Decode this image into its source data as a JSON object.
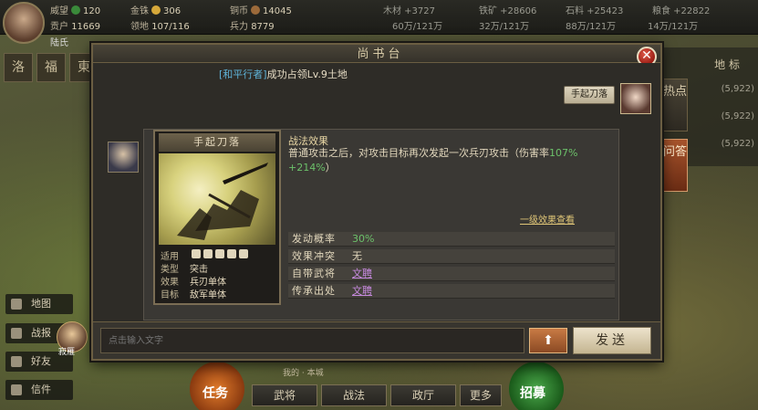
{
  "top_bar": {
    "res_row1": [
      {
        "label": "威望",
        "value": "120"
      },
      {
        "label": "金铢",
        "value": "306"
      },
      {
        "label": "铜币",
        "value": "14045"
      }
    ],
    "res_row2": [
      {
        "label": "贡户",
        "value": "11669"
      },
      {
        "label": "领地",
        "value": "107/116"
      },
      {
        "label": "兵力",
        "value": "8779"
      }
    ],
    "right_res_row1": [
      "木材 +3727",
      "铁矿 +28606",
      "石料 +25423",
      "粮食 +22822"
    ],
    "right_res_row2": [
      "60万/121万",
      "32万/121万",
      "88万/121万",
      "14万/121万"
    ],
    "player_name": "陆氏"
  },
  "left_tabs": [
    "洛",
    "福",
    "東"
  ],
  "left_menu": [
    "地图",
    "战报",
    "好友",
    "信件"
  ],
  "bottom_bar": {
    "tasks_label": "任务",
    "hero_name": "寂雁",
    "buttons": [
      "武将",
      "战法",
      "政厅",
      "更多"
    ],
    "recruit_label": "招募",
    "status_text": "我的 · 本城"
  },
  "right_panel": {
    "header_label": "地 标",
    "coord_rows": [
      "(5,922)",
      "(5,922)",
      "(5,922)"
    ]
  },
  "dialog": {
    "title": "尚书台",
    "close_glyph": "✕",
    "system_tag": "[和平行者]",
    "system_text": "成功占领Lv.9土地",
    "self_bubble": "手起刀落",
    "skill": {
      "name": "手起刀落",
      "effect_title": "战法效果",
      "desc_pre": "普通攻击之后，对攻击目标再次发起一次兵刃攻击（伤害率",
      "pct_from": "107%",
      "pct_to": "+214%",
      "desc_post": "）",
      "level_link": "一级效果查看",
      "props": [
        {
          "key": "适用",
          "value": ""
        },
        {
          "key": "类型",
          "value": "突击"
        },
        {
          "key": "效果",
          "value": "兵刃单体"
        },
        {
          "key": "目标",
          "value": "敌军单体"
        }
      ],
      "attrs": [
        {
          "key": "发动概率",
          "value": "30%",
          "style": "green"
        },
        {
          "key": "效果冲突",
          "value": "无",
          "style": "plain"
        },
        {
          "key": "自带武将",
          "value": "文聘",
          "style": "link"
        },
        {
          "key": "传承出处",
          "value": "文聘",
          "style": "link"
        }
      ]
    },
    "input_placeholder": "点击输入文字",
    "emote_glyph": "⬆",
    "send_label": "发送"
  },
  "side_tabs": [
    "热点",
    "问答"
  ]
}
